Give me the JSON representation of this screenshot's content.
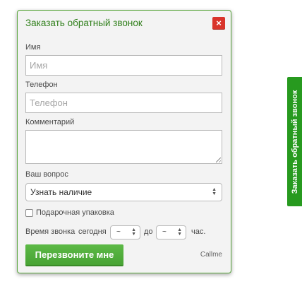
{
  "dialog": {
    "title": "Заказать обратный звонок",
    "close_symbol": "×",
    "name_label": "Имя",
    "name_placeholder": "Имя",
    "phone_label": "Телефон",
    "phone_placeholder": "Телефон",
    "comment_label": "Комментарий",
    "question_label": "Ваш вопрос",
    "question_selected": "Узнать наличие",
    "gift_label": "Подарочная упаковка",
    "gift_checked": false,
    "time_label": "Время звонка",
    "time_today": "сегодня",
    "from_value": "~",
    "to_label": "до",
    "to_value": "~",
    "hours_label": "час.",
    "submit_label": "Перезвоните мне",
    "brand_link": "Callme"
  },
  "side_tab": {
    "label": "Заказать обратный звонок"
  },
  "colors": {
    "accent_green": "#48a334",
    "title_green": "#2f7f1a",
    "close_red": "#d9342b",
    "tab_green": "#279a1f"
  }
}
